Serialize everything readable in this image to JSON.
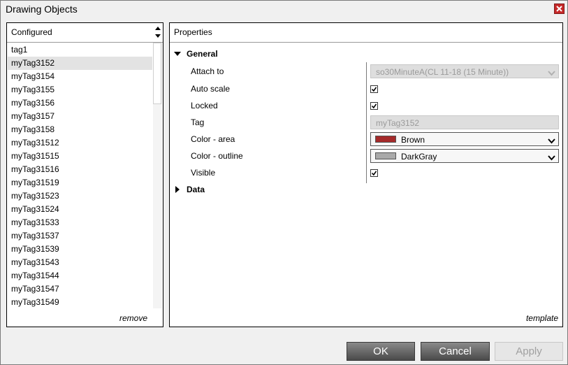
{
  "window": {
    "title": "Drawing Objects"
  },
  "left": {
    "header": "Configured",
    "items": [
      "tag1",
      "myTag3152",
      "myTag3154",
      "myTag3155",
      "myTag3156",
      "myTag3157",
      "myTag3158",
      "myTag31512",
      "myTag31515",
      "myTag31516",
      "myTag31519",
      "myTag31523",
      "myTag31524",
      "myTag31533",
      "myTag31537",
      "myTag31539",
      "myTag31543",
      "myTag31544",
      "myTag31547",
      "myTag31549"
    ],
    "selected_index": 1,
    "footer": "remove"
  },
  "right": {
    "header": "Properties",
    "general_label": "General",
    "data_label": "Data",
    "props": {
      "attach_label": "Attach to",
      "attach_value": "so30MinuteA(CL 11-18 (15 Minute))",
      "autoscale_label": "Auto scale",
      "autoscale_checked": true,
      "locked_label": "Locked",
      "locked_checked": true,
      "tag_label": "Tag",
      "tag_value": "myTag3152",
      "color_area_label": "Color - area",
      "color_area_value": "Brown",
      "color_area_hex": "#a52a2a",
      "color_outline_label": "Color - outline",
      "color_outline_value": "DarkGray",
      "color_outline_hex": "#a9a9a9",
      "visible_label": "Visible",
      "visible_checked": true
    },
    "footer": "template"
  },
  "buttons": {
    "ok": "OK",
    "cancel": "Cancel",
    "apply": "Apply"
  }
}
